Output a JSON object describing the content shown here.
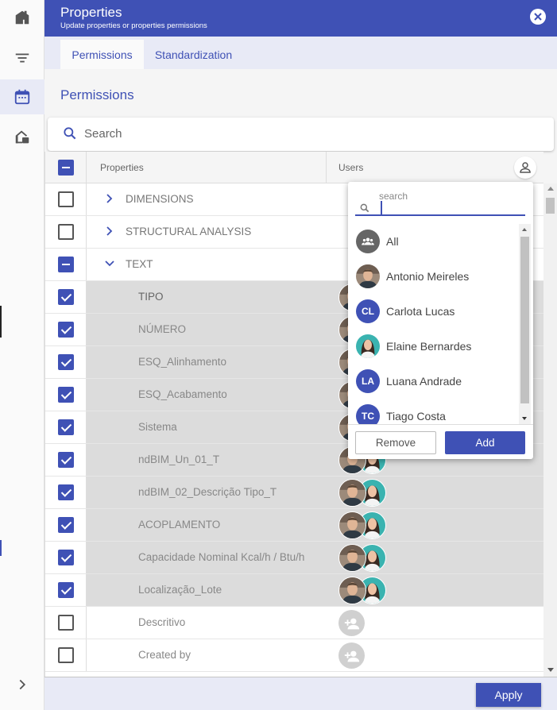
{
  "header": {
    "title": "Properties",
    "subtitle": "Update properties or properties permissions"
  },
  "tabs": [
    {
      "label": "Permissions",
      "active": true
    },
    {
      "label": "Standardization",
      "active": false
    }
  ],
  "section_title": "Permissions",
  "search": {
    "placeholder": "Search"
  },
  "table": {
    "columns": [
      "Properties",
      "Users"
    ],
    "groups": [
      {
        "label": "DIMENSIONS",
        "state": "unchecked",
        "expanded": false
      },
      {
        "label": "STRUCTURAL ANALYSIS",
        "state": "unchecked",
        "expanded": false
      },
      {
        "label": "TEXT",
        "state": "indeterminate",
        "expanded": true
      }
    ],
    "rows": [
      {
        "label": "TIPO",
        "checked": true
      },
      {
        "label": "NÚMERO",
        "checked": true
      },
      {
        "label": "ESQ_Alinhamento",
        "checked": true
      },
      {
        "label": "ESQ_Acabamento",
        "checked": true
      },
      {
        "label": "Sistema",
        "checked": true
      },
      {
        "label": "ndBIM_Un_01_T",
        "checked": true
      },
      {
        "label": "ndBIM_02_Descrição Tipo_T",
        "checked": true
      },
      {
        "label": "ACOPLAMENTO",
        "checked": true
      },
      {
        "label": "Capacidade Nominal Kcal/h / Btu/h",
        "checked": true
      },
      {
        "label": "Localização_Lote",
        "checked": true
      },
      {
        "label": "Descritivo",
        "checked": false
      },
      {
        "label": "Created by",
        "checked": false
      }
    ]
  },
  "user_picker": {
    "search_label": "search",
    "search_value": "",
    "users": [
      {
        "name": "All",
        "initials": "",
        "kind": "all"
      },
      {
        "name": "Antonio Meireles",
        "initials": "",
        "kind": "photo-male"
      },
      {
        "name": "Carlota Lucas",
        "initials": "CL",
        "kind": "initials"
      },
      {
        "name": "Elaine Bernardes",
        "initials": "",
        "kind": "photo-female"
      },
      {
        "name": "Luana Andrade",
        "initials": "LA",
        "kind": "initials"
      },
      {
        "name": "Tiago Costa",
        "initials": "TC",
        "kind": "initials"
      }
    ],
    "remove_label": "Remove",
    "add_label": "Add"
  },
  "footer": {
    "apply_label": "Apply"
  },
  "colors": {
    "primary": "#3f51b5",
    "tab_bg": "#e8eaf6",
    "selected_row": "#dcdcdc"
  }
}
